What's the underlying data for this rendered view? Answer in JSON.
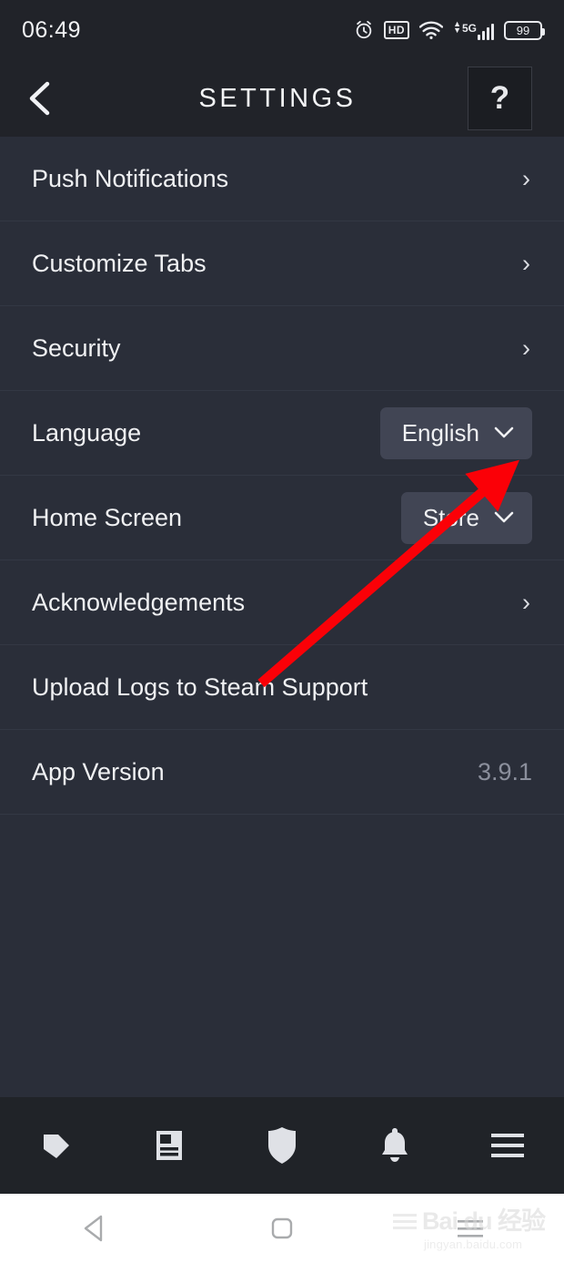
{
  "status_bar": {
    "time": "06:49",
    "icons": [
      "alarm-icon",
      "hd-icon",
      "wifi-icon",
      "signal-5g-icon",
      "battery-icon"
    ],
    "hd_label": "HD",
    "network_label": "5G",
    "battery_level": "99"
  },
  "header": {
    "back_label": "‹",
    "title": "SETTINGS",
    "help_label": "?"
  },
  "settings": {
    "rows": [
      {
        "label": "Push Notifications",
        "type": "chevron",
        "value": "›"
      },
      {
        "label": "Customize Tabs",
        "type": "chevron",
        "value": "›"
      },
      {
        "label": "Security",
        "type": "chevron",
        "value": "›"
      },
      {
        "label": "Language",
        "type": "dropdown",
        "value": "English",
        "caret": "⌄"
      },
      {
        "label": "Home Screen",
        "type": "dropdown",
        "value": "Store",
        "caret": "⌄"
      },
      {
        "label": "Acknowledgements",
        "type": "chevron",
        "value": "›"
      },
      {
        "label": "Upload Logs to Steam Support",
        "type": "plain",
        "value": ""
      },
      {
        "label": "App Version",
        "type": "text",
        "value": "3.9.1"
      }
    ]
  },
  "annotation": {
    "color": "#fb0007",
    "type": "arrow",
    "points_to": "Language dropdown"
  },
  "bottom_nav": {
    "items": [
      {
        "icon": "tag-icon",
        "name": "store"
      },
      {
        "icon": "news-icon",
        "name": "news"
      },
      {
        "icon": "shield-icon",
        "name": "community"
      },
      {
        "icon": "bell-icon",
        "name": "notifications"
      },
      {
        "icon": "menu-icon",
        "name": "more"
      }
    ]
  },
  "system_nav": {
    "items": [
      {
        "icon": "triangle-back-icon",
        "name": "back"
      },
      {
        "icon": "square-home-icon",
        "name": "home"
      },
      {
        "icon": "recents-icon",
        "name": "recents"
      }
    ]
  },
  "watermark": {
    "main": "Bai du 经验",
    "sub": "jingyan.baidu.com"
  },
  "colors": {
    "header_bg": "#212329",
    "list_bg": "#2a2e39",
    "pill_bg": "#414554",
    "divider": "#333844",
    "text": "#f0f1f3",
    "muted": "#8b8f9c",
    "annotation": "#fb0007",
    "nav_bg": "#202328"
  }
}
